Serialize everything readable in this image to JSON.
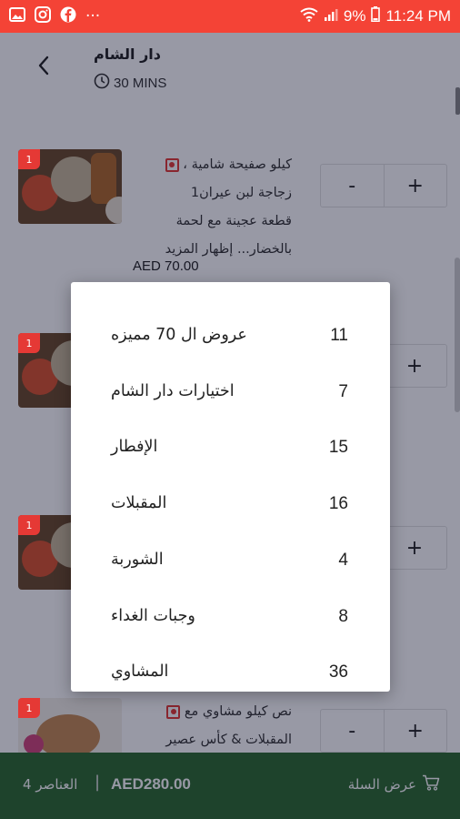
{
  "status_bar": {
    "battery": "9%",
    "time": "11:24 PM",
    "dots": "···",
    "icons": [
      "gallery-icon",
      "instagram-icon",
      "facebook-icon",
      "wifi-icon",
      "signal-icon",
      "battery-icon"
    ]
  },
  "header": {
    "store_name": "دار الشام",
    "eta": "30 MINS"
  },
  "items": [
    {
      "badge": "1",
      "title_lines": [
        "كيلو صفيحة شامية ،",
        "زجاجة لبن عيران1",
        "قطعة عجينة مع لحمة",
        "بالخضار... إظهار المزيد"
      ],
      "price": "AED 70.00",
      "minus": "-",
      "plus": "+"
    },
    {
      "badge": "1",
      "plus": "+"
    },
    {
      "badge": "1",
      "plus": "+"
    },
    {
      "badge": "1",
      "title_lines": [
        "نص كيلو مشاوي مع",
        "المقبلات & كأس عصير"
      ],
      "minus": "-",
      "plus": "+"
    }
  ],
  "categories": [
    {
      "name": "عروض ال 70 مميزه",
      "count": "11"
    },
    {
      "name": "اختيارات دار الشام",
      "count": "7"
    },
    {
      "name": "الإفطار",
      "count": "15"
    },
    {
      "name": "المقبلات",
      "count": "16"
    },
    {
      "name": "الشوربة",
      "count": "4"
    },
    {
      "name": "وجبات الغداء",
      "count": "8"
    },
    {
      "name": "المشاوي",
      "count": "36"
    }
  ],
  "cart": {
    "count_label": "العناصر 4",
    "separator": "|",
    "total": "AED280.00",
    "view_label": "عرض السلة"
  },
  "colors": {
    "status_bar": "#f44336",
    "cart_bar": "#2e6b30",
    "badge": "#e53935"
  }
}
